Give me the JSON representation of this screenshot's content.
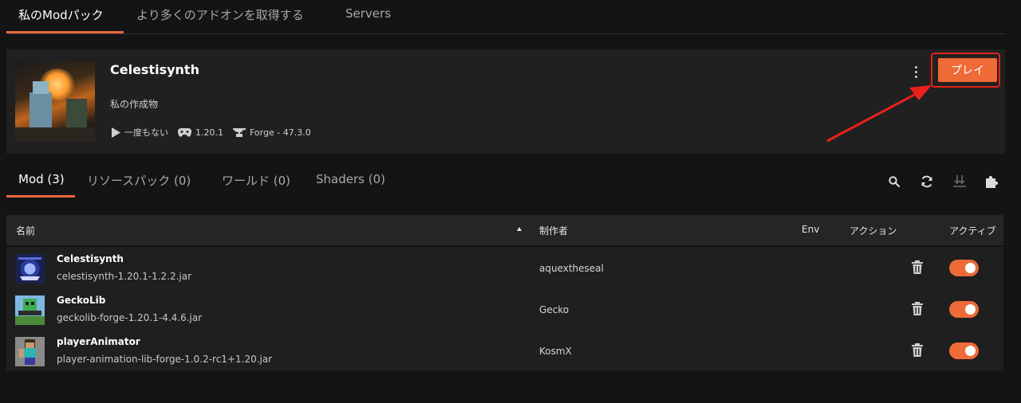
{
  "top_tabs": [
    {
      "label": "私のModパック",
      "active": true
    },
    {
      "label": "より多くのアドオンを取得する",
      "active": false
    },
    {
      "label": "Servers",
      "active": false
    }
  ],
  "pack": {
    "title": "Celestisynth",
    "description": "私の作成物",
    "last_played": "一度もない",
    "game_version": "1.20.1",
    "loader": "Forge - 47.3.0",
    "play_label": "プレイ"
  },
  "section_tabs": [
    {
      "label": "Mod (3)",
      "active": true
    },
    {
      "label": "リソースパック (0)",
      "active": false
    },
    {
      "label": "ワールド (0)",
      "active": false
    },
    {
      "label": "Shaders (0)",
      "active": false
    }
  ],
  "toolbar_icons": [
    "search-icon",
    "refresh-icon",
    "download-icon",
    "puzzle-icon"
  ],
  "table": {
    "headers": {
      "name": "名前",
      "author": "制作者",
      "env": "Env",
      "actions": "アクション",
      "active": "アクティブ"
    },
    "rows": [
      {
        "name": "Celestisynth",
        "file": "celestisynth-1.20.1-1.2.2.jar",
        "author": "aquextheseal",
        "enabled": true
      },
      {
        "name": "GeckoLib",
        "file": "geckolib-forge-1.20.1-4.4.6.jar",
        "author": "Gecko",
        "enabled": true
      },
      {
        "name": "playerAnimator",
        "file": "player-animation-lib-forge-1.0.2-rc1+1.20.jar",
        "author": "KosmX",
        "enabled": true
      }
    ]
  },
  "colors": {
    "accent": "#ee6a37",
    "highlight": "#e8211c",
    "background": "#141414",
    "card": "#202020"
  }
}
